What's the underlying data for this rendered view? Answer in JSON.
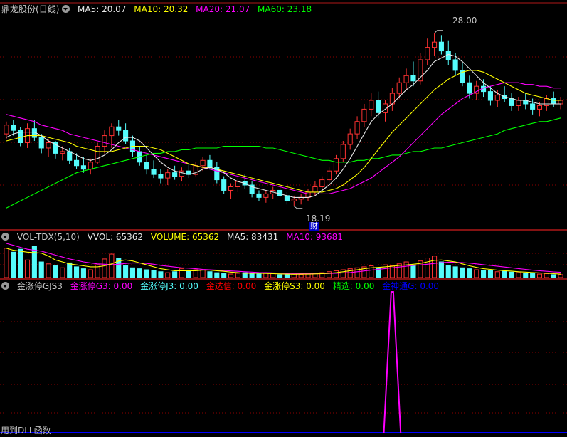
{
  "stock": {
    "name": "鼎龙股份",
    "period": "(日线)"
  },
  "colors": {
    "bg": "#000000",
    "up": "#ff3232",
    "down": "#54fcfc",
    "ma5": "#e6e6e6",
    "ma10": "#ffff00",
    "ma20": "#ff00ff",
    "ma60": "#00ff00",
    "grid": "#8b0000",
    "border": "#b01818"
  },
  "price_panel": {
    "indicators": [
      {
        "label": "MA5: 20.07",
        "color": "#e6e6e6"
      },
      {
        "label": "MA10: 20.32",
        "color": "#ffff00"
      },
      {
        "label": "MA20: 21.07",
        "color": "#ff00ff"
      },
      {
        "label": "MA60: 23.18",
        "color": "#00ff00"
      }
    ],
    "high_label": "28.00",
    "low_label": "18.19",
    "marker_label": "财"
  },
  "volume_panel": {
    "indicators": [
      {
        "label": "VOL-TDX(5,10)",
        "color": "#c8c8c8"
      },
      {
        "label": "VVOL: 65362",
        "color": "#e6e6e6"
      },
      {
        "label": "VOLUME: 65362",
        "color": "#ffff00"
      },
      {
        "label": "MA5: 83431",
        "color": "#e6e6e6"
      },
      {
        "label": "MA10: 93681",
        "color": "#ff00ff"
      }
    ]
  },
  "signal_panel": {
    "indicators": [
      {
        "label": "金涨停GJS3",
        "color": "#c8c8c8"
      },
      {
        "label": "金涨停G3: 0.00",
        "color": "#ff00ff"
      },
      {
        "label": "金涨停J3: 0.00",
        "color": "#54fcfc"
      },
      {
        "label": "金达信: 0.00",
        "color": "#ff0000"
      },
      {
        "label": "金涨停S3: 0.00",
        "color": "#ffff00"
      },
      {
        "label": "精选: 0.00",
        "color": "#00ff00"
      },
      {
        "label": "金神通G: 0.00",
        "color": "#0000ff"
      }
    ],
    "footer": "用到DLL函数"
  },
  "chart_data": {
    "type": "candlestick",
    "price_range": [
      16.9,
      29.0
    ],
    "high": 28.0,
    "low": 18.19,
    "ohlc": [
      [
        22.3,
        23.0,
        22.0,
        22.8
      ],
      [
        22.8,
        23.1,
        22.2,
        22.5
      ],
      [
        22.5,
        22.7,
        21.6,
        21.8
      ],
      [
        21.8,
        22.9,
        21.5,
        22.6
      ],
      [
        22.6,
        23.1,
        21.9,
        22.1
      ],
      [
        22.1,
        22.3,
        21.2,
        21.5
      ],
      [
        21.5,
        22.0,
        21.0,
        21.8
      ],
      [
        21.8,
        21.9,
        20.9,
        21.2
      ],
      [
        21.2,
        21.6,
        20.8,
        21.3
      ],
      [
        21.3,
        21.5,
        20.6,
        20.8
      ],
      [
        20.8,
        21.2,
        20.3,
        20.5
      ],
      [
        20.5,
        21.0,
        20.1,
        20.3
      ],
      [
        20.3,
        20.9,
        20.0,
        20.7
      ],
      [
        20.7,
        21.8,
        20.6,
        21.6
      ],
      [
        21.6,
        22.5,
        21.2,
        22.2
      ],
      [
        22.2,
        22.9,
        21.5,
        22.7
      ],
      [
        22.7,
        23.1,
        22.2,
        22.5
      ],
      [
        22.5,
        22.9,
        21.7,
        21.9
      ],
      [
        21.9,
        22.2,
        21.0,
        21.3
      ],
      [
        21.3,
        21.6,
        20.5,
        20.7
      ],
      [
        20.7,
        21.1,
        20.0,
        20.3
      ],
      [
        20.3,
        20.8,
        19.8,
        20.0
      ],
      [
        20.0,
        20.3,
        19.5,
        19.8
      ],
      [
        19.8,
        20.3,
        19.4,
        20.1
      ],
      [
        20.1,
        20.5,
        19.7,
        19.9
      ],
      [
        19.9,
        20.4,
        19.6,
        20.2
      ],
      [
        20.2,
        20.6,
        19.8,
        20.0
      ],
      [
        20.0,
        20.7,
        19.9,
        20.5
      ],
      [
        20.5,
        21.0,
        20.2,
        20.8
      ],
      [
        20.8,
        21.1,
        20.3,
        20.4
      ],
      [
        20.4,
        20.7,
        19.5,
        19.7
      ],
      [
        19.7,
        19.9,
        18.9,
        19.1
      ],
      [
        19.1,
        19.5,
        18.6,
        19.3
      ],
      [
        19.3,
        19.8,
        19.0,
        19.6
      ],
      [
        19.6,
        20.0,
        19.2,
        19.4
      ],
      [
        19.4,
        19.6,
        18.7,
        18.9
      ],
      [
        18.9,
        19.1,
        18.5,
        18.7
      ],
      [
        18.7,
        19.1,
        18.4,
        18.9
      ],
      [
        18.9,
        19.3,
        18.6,
        19.1
      ],
      [
        19.1,
        19.3,
        18.7,
        18.8
      ],
      [
        18.8,
        19.0,
        18.3,
        18.5
      ],
      [
        18.5,
        18.8,
        18.2,
        18.6
      ],
      [
        18.6,
        18.9,
        18.3,
        18.7
      ],
      [
        18.7,
        19.2,
        18.5,
        19.0
      ],
      [
        19.0,
        19.6,
        18.8,
        19.3
      ],
      [
        19.3,
        19.9,
        19.1,
        19.7
      ],
      [
        19.7,
        20.4,
        19.5,
        20.2
      ],
      [
        20.2,
        21.1,
        20.0,
        20.9
      ],
      [
        20.9,
        21.9,
        20.7,
        21.7
      ],
      [
        21.7,
        22.6,
        21.4,
        22.3
      ],
      [
        22.3,
        23.3,
        22.0,
        23.0
      ],
      [
        23.0,
        24.0,
        22.7,
        23.7
      ],
      [
        23.7,
        24.6,
        23.3,
        24.2
      ],
      [
        24.2,
        24.7,
        23.2,
        23.5
      ],
      [
        23.5,
        24.2,
        23.0,
        24.0
      ],
      [
        24.0,
        24.9,
        23.6,
        24.6
      ],
      [
        24.6,
        25.5,
        24.3,
        25.2
      ],
      [
        25.2,
        26.0,
        24.8,
        25.6
      ],
      [
        25.6,
        26.4,
        25.0,
        25.3
      ],
      [
        25.3,
        26.9,
        25.1,
        26.5
      ],
      [
        26.5,
        27.7,
        26.2,
        27.2
      ],
      [
        27.2,
        28.0,
        26.7,
        27.5
      ],
      [
        27.5,
        27.9,
        26.8,
        27.0
      ],
      [
        27.0,
        27.6,
        26.2,
        26.5
      ],
      [
        26.5,
        26.9,
        25.6,
        25.9
      ],
      [
        25.9,
        26.3,
        25.0,
        25.2
      ],
      [
        25.2,
        25.6,
        24.3,
        24.6
      ],
      [
        24.6,
        25.3,
        24.2,
        25.0
      ],
      [
        25.0,
        25.4,
        24.4,
        24.7
      ],
      [
        24.7,
        25.0,
        23.9,
        24.2
      ],
      [
        24.2,
        24.8,
        23.8,
        24.5
      ],
      [
        24.5,
        25.0,
        24.1,
        24.3
      ],
      [
        24.3,
        24.6,
        23.6,
        23.9
      ],
      [
        23.9,
        24.4,
        23.6,
        24.2
      ],
      [
        24.2,
        24.6,
        23.7,
        24.0
      ],
      [
        24.0,
        24.3,
        23.4,
        23.7
      ],
      [
        23.7,
        24.1,
        23.3,
        23.9
      ],
      [
        23.9,
        24.5,
        23.6,
        24.3
      ],
      [
        24.3,
        24.7,
        23.8,
        24.0
      ],
      [
        24.0,
        24.4,
        23.7,
        24.2
      ]
    ],
    "ma5": [
      22.1,
      22.3,
      22.4,
      22.4,
      22.4,
      22.2,
      21.9,
      21.7,
      21.5,
      21.3,
      21.1,
      20.9,
      20.8,
      20.9,
      21.1,
      21.4,
      21.8,
      22.1,
      22.1,
      21.9,
      21.5,
      21.1,
      20.7,
      20.4,
      20.2,
      20.1,
      20.0,
      20.1,
      20.3,
      20.4,
      20.3,
      20.1,
      19.8,
      19.6,
      19.5,
      19.3,
      19.2,
      19.1,
      19.0,
      18.9,
      18.8,
      18.7,
      18.7,
      18.7,
      18.8,
      19.1,
      19.4,
      19.8,
      20.3,
      20.9,
      21.6,
      22.3,
      23.0,
      23.4,
      23.7,
      24.0,
      24.4,
      24.8,
      25.1,
      25.5,
      25.9,
      26.4,
      26.6,
      26.8,
      26.7,
      26.4,
      26.0,
      25.6,
      25.2,
      24.9,
      24.6,
      24.4,
      24.3,
      24.2,
      24.2,
      24.1,
      24.0,
      24.0,
      24.0,
      24.0
    ],
    "ma10": [
      21.9,
      22.0,
      22.1,
      22.2,
      22.2,
      22.2,
      22.1,
      22.0,
      21.9,
      21.8,
      21.6,
      21.5,
      21.4,
      21.3,
      21.3,
      21.3,
      21.4,
      21.5,
      21.6,
      21.6,
      21.6,
      21.5,
      21.4,
      21.2,
      21.0,
      20.8,
      20.6,
      20.5,
      20.4,
      20.4,
      20.3,
      20.2,
      20.1,
      20.0,
      19.9,
      19.8,
      19.7,
      19.6,
      19.5,
      19.4,
      19.3,
      19.2,
      19.1,
      19.0,
      19.0,
      19.0,
      19.1,
      19.2,
      19.4,
      19.7,
      20.0,
      20.4,
      20.9,
      21.4,
      21.9,
      22.4,
      22.8,
      23.2,
      23.6,
      24.0,
      24.4,
      24.8,
      25.1,
      25.4,
      25.6,
      25.8,
      25.9,
      25.9,
      25.8,
      25.6,
      25.4,
      25.2,
      25.0,
      24.8,
      24.6,
      24.5,
      24.4,
      24.3,
      24.2,
      24.2
    ],
    "ma20": [
      23.4,
      23.3,
      23.2,
      23.1,
      23.0,
      22.8,
      22.7,
      22.6,
      22.5,
      22.3,
      22.2,
      22.1,
      22.0,
      21.9,
      21.8,
      21.7,
      21.6,
      21.5,
      21.4,
      21.3,
      21.2,
      21.1,
      21.0,
      20.9,
      20.8,
      20.7,
      20.6,
      20.5,
      20.4,
      20.3,
      20.2,
      20.1,
      20.0,
      19.9,
      19.8,
      19.7,
      19.6,
      19.5,
      19.4,
      19.3,
      19.2,
      19.1,
      19.0,
      18.9,
      18.9,
      18.9,
      18.9,
      19.0,
      19.1,
      19.2,
      19.4,
      19.6,
      19.8,
      20.1,
      20.4,
      20.7,
      21.0,
      21.4,
      21.8,
      22.2,
      22.6,
      23.0,
      23.4,
      23.7,
      24.0,
      24.3,
      24.5,
      24.7,
      24.9,
      25.0,
      25.1,
      25.2,
      25.2,
      25.2,
      25.1,
      25.1,
      25.0,
      25.0,
      24.9,
      24.9
    ],
    "ma60": [
      18.1,
      18.3,
      18.5,
      18.7,
      18.9,
      19.1,
      19.3,
      19.5,
      19.7,
      19.9,
      20.1,
      20.2,
      20.3,
      20.4,
      20.5,
      20.6,
      20.7,
      20.8,
      20.9,
      21.0,
      21.1,
      21.2,
      21.2,
      21.3,
      21.3,
      21.4,
      21.4,
      21.5,
      21.5,
      21.5,
      21.5,
      21.6,
      21.6,
      21.6,
      21.6,
      21.6,
      21.6,
      21.5,
      21.5,
      21.4,
      21.3,
      21.2,
      21.1,
      21.0,
      20.9,
      20.8,
      20.8,
      20.7,
      20.7,
      20.7,
      20.8,
      20.8,
      20.9,
      20.9,
      21.0,
      21.1,
      21.1,
      21.2,
      21.3,
      21.3,
      21.4,
      21.5,
      21.5,
      21.6,
      21.7,
      21.8,
      21.9,
      22.0,
      22.1,
      22.2,
      22.3,
      22.5,
      22.6,
      22.7,
      22.8,
      22.9,
      23.0,
      23.0,
      23.1,
      23.2
    ],
    "volume": [
      150,
      130,
      145,
      90,
      160,
      80,
      70,
      60,
      50,
      75,
      55,
      45,
      40,
      65,
      95,
      120,
      100,
      60,
      50,
      45,
      40,
      35,
      30,
      25,
      30,
      45,
      35,
      40,
      40,
      30,
      25,
      20,
      18,
      22,
      25,
      20,
      18,
      22,
      20,
      15,
      18,
      20,
      15,
      18,
      22,
      25,
      30,
      35,
      40,
      45,
      50,
      55,
      60,
      50,
      65,
      60,
      70,
      80,
      60,
      85,
      100,
      110,
      80,
      60,
      55,
      50,
      45,
      40,
      38,
      35,
      30,
      32,
      28,
      25,
      22,
      20,
      18,
      20,
      15,
      15
    ],
    "vol_ma5": [
      150,
      140,
      135,
      130,
      128,
      125,
      110,
      90,
      80,
      70,
      65,
      60,
      55,
      55,
      60,
      70,
      85,
      90,
      85,
      75,
      65,
      55,
      45,
      40,
      35,
      35,
      35,
      35,
      38,
      38,
      35,
      32,
      28,
      25,
      22,
      22,
      22,
      21,
      20,
      19,
      18,
      17,
      18,
      18,
      19,
      20,
      22,
      25,
      30,
      35,
      40,
      45,
      50,
      52,
      55,
      58,
      62,
      65,
      68,
      72,
      80,
      88,
      90,
      85,
      80,
      70,
      60,
      52,
      45,
      42,
      38,
      35,
      33,
      30,
      28,
      26,
      24,
      22,
      20,
      18
    ],
    "vol_ma10": [
      175,
      165,
      155,
      145,
      140,
      135,
      125,
      115,
      105,
      95,
      88,
      80,
      75,
      70,
      68,
      66,
      68,
      72,
      75,
      74,
      72,
      68,
      62,
      58,
      54,
      50,
      48,
      45,
      42,
      40,
      38,
      36,
      34,
      32,
      30,
      28,
      26,
      25,
      24,
      23,
      22,
      21,
      20,
      20,
      20,
      20,
      21,
      22,
      24,
      26,
      30,
      34,
      38,
      42,
      46,
      50,
      54,
      58,
      62,
      65,
      68,
      72,
      76,
      78,
      78,
      76,
      74,
      70,
      66,
      62,
      58,
      54,
      50,
      46,
      42,
      38,
      35,
      32,
      29,
      27
    ],
    "signal": {
      "index": 55,
      "value": 1
    }
  }
}
